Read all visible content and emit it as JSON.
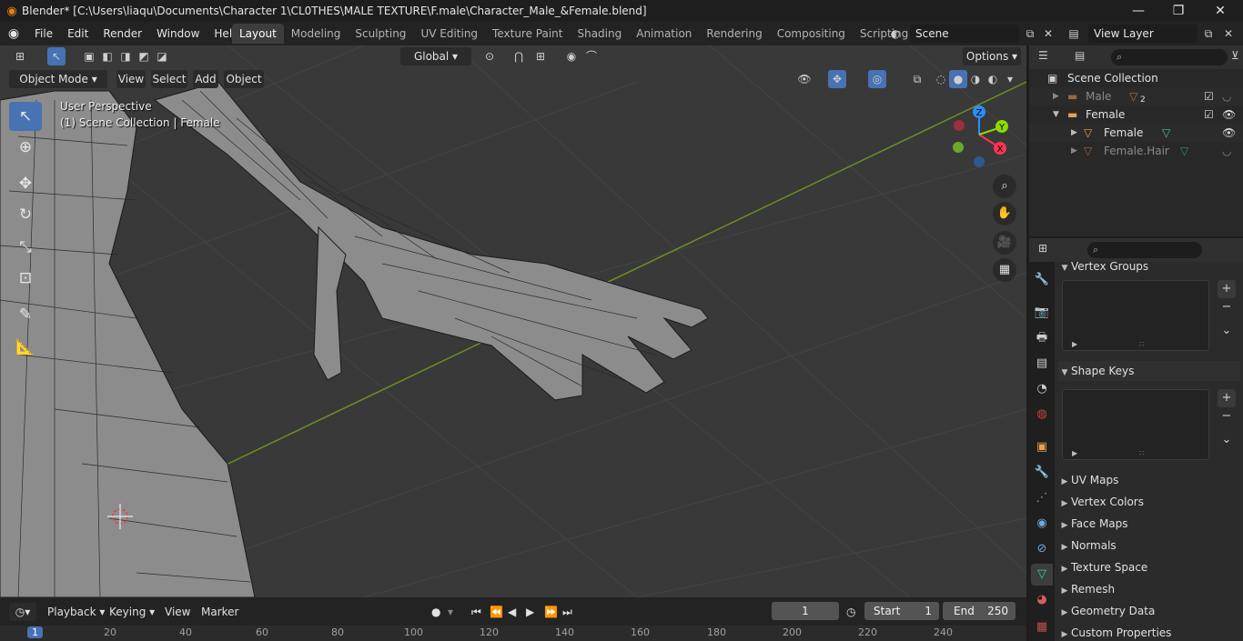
{
  "window": {
    "title": "Blender* [C:\\Users\\liaqu\\Documents\\Character 1\\CL0THES\\MALE TEXTURE\\F.male\\Character_Male_&Female.blend]",
    "minimize": "—",
    "maximize": "❐",
    "close": "✕"
  },
  "menu": [
    "File",
    "Edit",
    "Render",
    "Window",
    "Help"
  ],
  "workspaces": [
    "Layout",
    "Modeling",
    "Sculpting",
    "UV Editing",
    "Texture Paint",
    "Shading",
    "Animation",
    "Rendering",
    "Compositing",
    "Scripting"
  ],
  "active_workspace": "Layout",
  "scene_name": "Scene",
  "view_layer": "View Layer",
  "viewport": {
    "orientation": "Global",
    "options": "Options",
    "mode": "Object Mode",
    "header_menu": [
      "View",
      "Select",
      "Add",
      "Object"
    ],
    "perspective_label": "User Perspective",
    "collection_label": "(1) Scene Collection | Female",
    "gizmo_axes": {
      "x": "X",
      "y": "Y",
      "z": "Z"
    }
  },
  "outliner": {
    "root": "Scene Collection",
    "rows": [
      {
        "label": "Male",
        "badge": "2",
        "dim": true
      },
      {
        "label": "Female",
        "dim": false
      },
      {
        "label": "Female",
        "dim": false
      },
      {
        "label": "Female.Hair",
        "dim": true
      }
    ]
  },
  "properties": {
    "panels_expanded": [
      "Vertex Groups",
      "Shape Keys"
    ],
    "panels_collapsed": [
      "UV Maps",
      "Vertex Colors",
      "Face Maps",
      "Normals",
      "Texture Space",
      "Remesh",
      "Geometry Data",
      "Custom Properties"
    ]
  },
  "timeline": {
    "menus": [
      "Playback",
      "Keying",
      "View",
      "Marker"
    ],
    "current_frame": "1",
    "start_label": "Start",
    "start": "1",
    "end_label": "End",
    "end": "250",
    "ruler_ticks": [
      "1",
      "20",
      "40",
      "60",
      "80",
      "100",
      "120",
      "140",
      "160",
      "180",
      "200",
      "220",
      "240"
    ]
  },
  "colors": {
    "accent": "#4772b3",
    "viewport_bg": "#393939",
    "x_axis": "#ff3352",
    "y_axis": "#8bdc00",
    "z_axis": "#2890ff"
  }
}
